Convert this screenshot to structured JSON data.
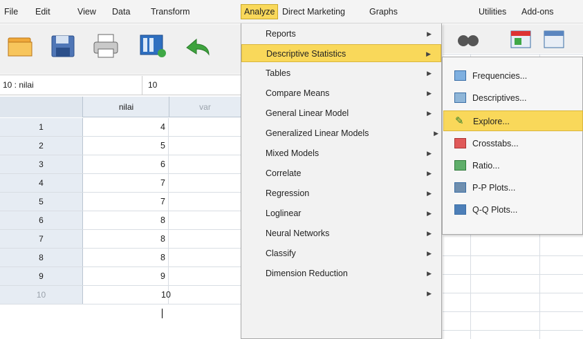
{
  "menubar": {
    "items": [
      {
        "label": "File"
      },
      {
        "label": "Edit"
      },
      {
        "label": "View"
      },
      {
        "label": "Data"
      },
      {
        "label": "Transform"
      },
      {
        "label": "Analyze"
      },
      {
        "label": "Direct Marketing"
      },
      {
        "label": "Graphs"
      },
      {
        "label": "Utilities"
      },
      {
        "label": "Add-ons"
      }
    ]
  },
  "cellbar": {
    "ref": "10 : nilai",
    "value": "10"
  },
  "grid": {
    "columns": [
      "nilai",
      "var"
    ],
    "rows": [
      {
        "n": "1",
        "v": "4"
      },
      {
        "n": "2",
        "v": "5"
      },
      {
        "n": "3",
        "v": "6"
      },
      {
        "n": "4",
        "v": "7"
      },
      {
        "n": "5",
        "v": "7"
      },
      {
        "n": "6",
        "v": "8"
      },
      {
        "n": "7",
        "v": "8"
      },
      {
        "n": "8",
        "v": "8"
      },
      {
        "n": "9",
        "v": "9"
      },
      {
        "n": "10",
        "v": "10"
      }
    ]
  },
  "analyze_menu": {
    "items": [
      {
        "label": "Reports"
      },
      {
        "label": "Descriptive Statistics"
      },
      {
        "label": "Tables"
      },
      {
        "label": "Compare Means"
      },
      {
        "label": "General Linear Model"
      },
      {
        "label": "Generalized Linear Models"
      },
      {
        "label": "Mixed Models"
      },
      {
        "label": "Correlate"
      },
      {
        "label": "Regression"
      },
      {
        "label": "Loglinear"
      },
      {
        "label": "Neural Networks"
      },
      {
        "label": "Classify"
      },
      {
        "label": "Dimension Reduction"
      }
    ]
  },
  "descriptive_submenu": {
    "items": [
      {
        "label": "Frequencies..."
      },
      {
        "label": "Descriptives..."
      },
      {
        "label": "Explore..."
      },
      {
        "label": "Crosstabs..."
      },
      {
        "label": "Ratio..."
      },
      {
        "label": "P-P Plots..."
      },
      {
        "label": "Q-Q Plots..."
      }
    ]
  },
  "colors": {
    "highlight": "#f9d85a",
    "header_bg": "#e6ecf3"
  }
}
